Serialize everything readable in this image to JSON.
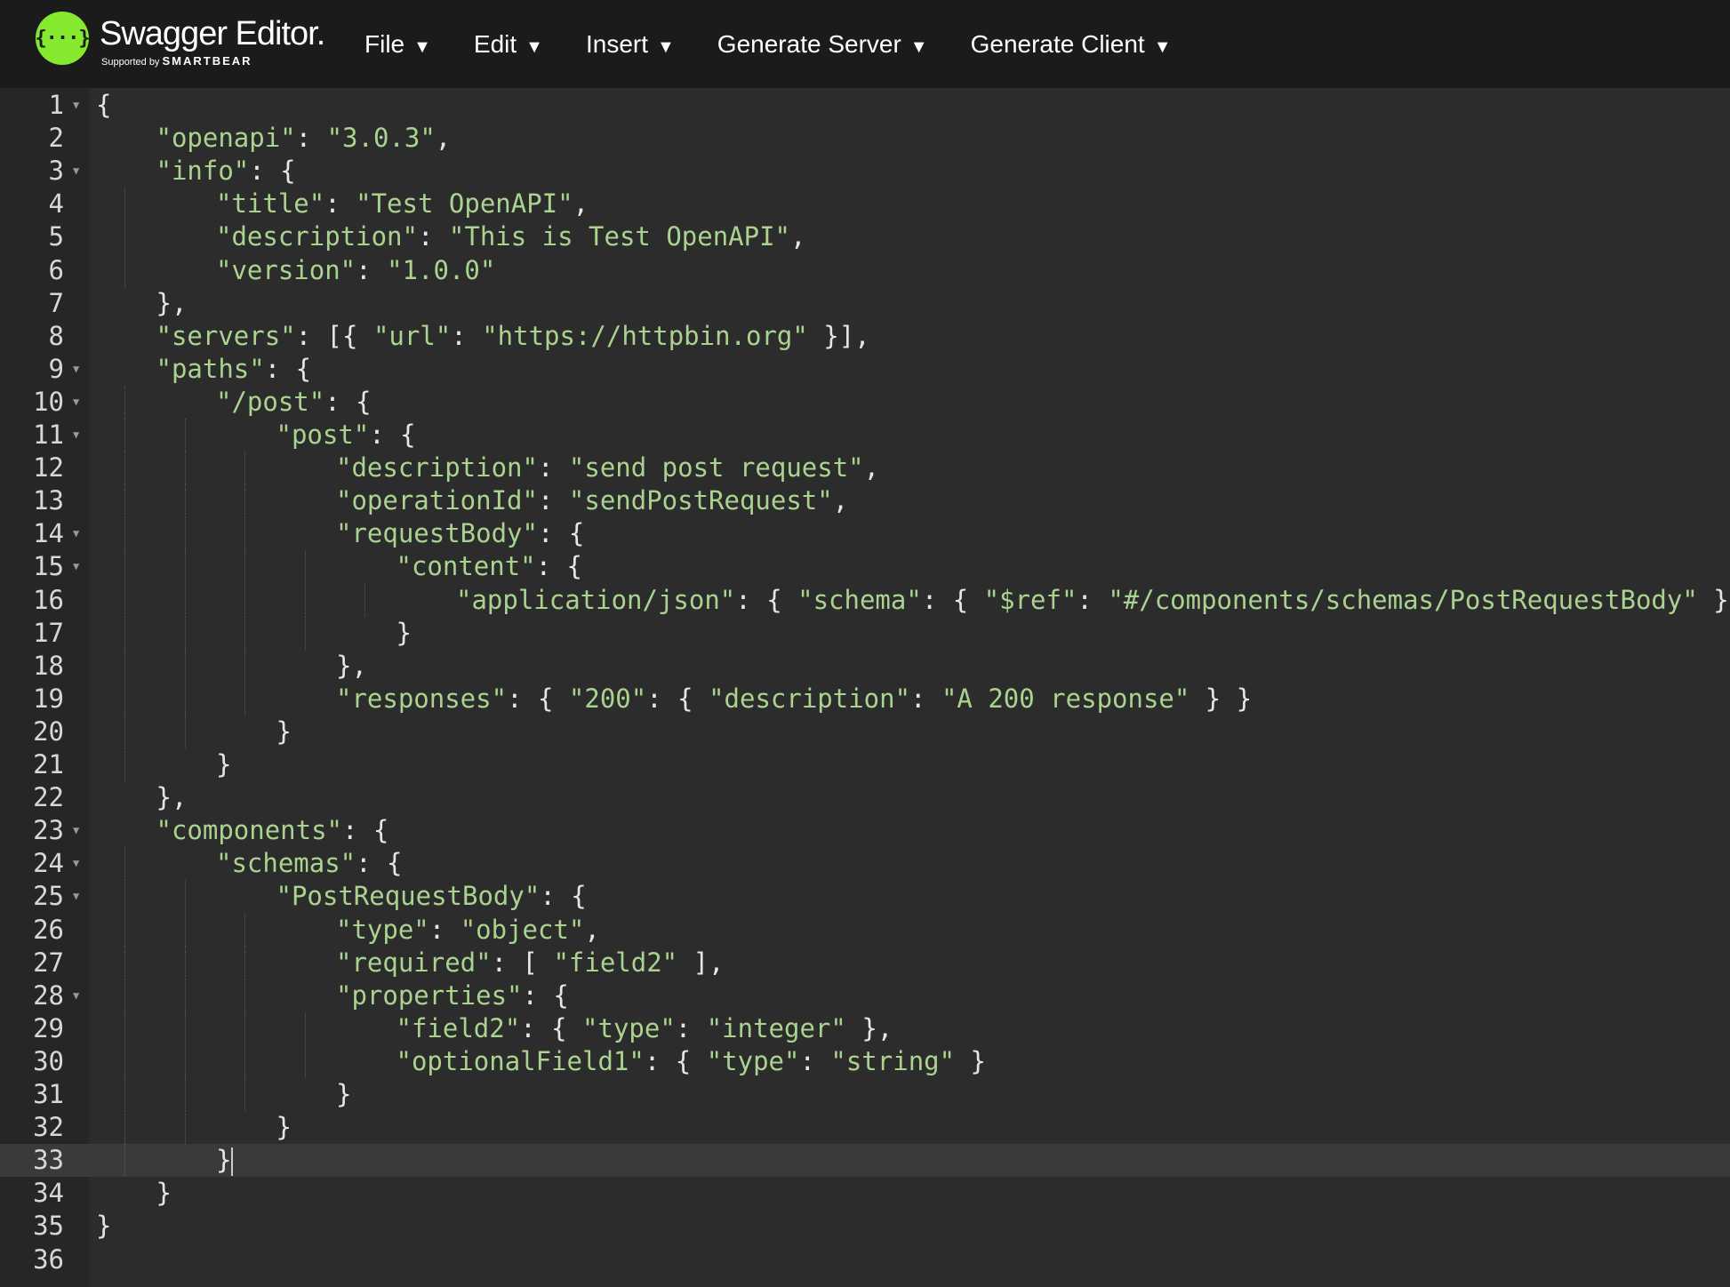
{
  "header": {
    "logo_symbol": "{···}",
    "app_title": "Swagger Editor.",
    "supported_by": "Supported by",
    "brand": "SMARTBEAR",
    "menu": [
      {
        "label": "File"
      },
      {
        "label": "Edit"
      },
      {
        "label": "Insert"
      },
      {
        "label": "Generate Server"
      },
      {
        "label": "Generate Client"
      }
    ]
  },
  "editor": {
    "active_line": 33,
    "lines": [
      {
        "n": "1",
        "indent": 0,
        "fold": true,
        "text": "{"
      },
      {
        "n": "2",
        "indent": 1,
        "fold": false,
        "text": "\"openapi\": \"3.0.3\","
      },
      {
        "n": "3",
        "indent": 1,
        "fold": true,
        "text": "\"info\": {"
      },
      {
        "n": "4",
        "indent": 2,
        "fold": false,
        "text": "\"title\": \"Test OpenAPI\","
      },
      {
        "n": "5",
        "indent": 2,
        "fold": false,
        "text": "\"description\": \"This is Test OpenAPI\","
      },
      {
        "n": "6",
        "indent": 2,
        "fold": false,
        "text": "\"version\": \"1.0.0\""
      },
      {
        "n": "7",
        "indent": 1,
        "fold": false,
        "text": "},"
      },
      {
        "n": "8",
        "indent": 1,
        "fold": false,
        "text": "\"servers\": [{ \"url\": \"https://httpbin.org\" }],"
      },
      {
        "n": "9",
        "indent": 1,
        "fold": true,
        "text": "\"paths\": {"
      },
      {
        "n": "10",
        "indent": 2,
        "fold": true,
        "text": "\"/post\": {"
      },
      {
        "n": "11",
        "indent": 3,
        "fold": true,
        "text": "\"post\": {"
      },
      {
        "n": "12",
        "indent": 4,
        "fold": false,
        "text": "\"description\": \"send post request\","
      },
      {
        "n": "13",
        "indent": 4,
        "fold": false,
        "text": "\"operationId\": \"sendPostRequest\","
      },
      {
        "n": "14",
        "indent": 4,
        "fold": true,
        "text": "\"requestBody\": {"
      },
      {
        "n": "15",
        "indent": 5,
        "fold": true,
        "text": "\"content\": {"
      },
      {
        "n": "16",
        "indent": 6,
        "fold": false,
        "text": "\"application/json\": { \"schema\": { \"$ref\": \"#/components/schemas/PostRequestBody\" } }"
      },
      {
        "n": "17",
        "indent": 5,
        "fold": false,
        "text": "}"
      },
      {
        "n": "18",
        "indent": 4,
        "fold": false,
        "text": "},"
      },
      {
        "n": "19",
        "indent": 4,
        "fold": false,
        "text": "\"responses\": { \"200\": { \"description\": \"A 200 response\" } }"
      },
      {
        "n": "20",
        "indent": 3,
        "fold": false,
        "text": "}"
      },
      {
        "n": "21",
        "indent": 2,
        "fold": false,
        "text": "}"
      },
      {
        "n": "22",
        "indent": 1,
        "fold": false,
        "text": "},"
      },
      {
        "n": "23",
        "indent": 1,
        "fold": true,
        "text": "\"components\": {"
      },
      {
        "n": "24",
        "indent": 2,
        "fold": true,
        "text": "\"schemas\": {"
      },
      {
        "n": "25",
        "indent": 3,
        "fold": true,
        "text": "\"PostRequestBody\": {"
      },
      {
        "n": "26",
        "indent": 4,
        "fold": false,
        "text": "\"type\": \"object\","
      },
      {
        "n": "27",
        "indent": 4,
        "fold": false,
        "text": "\"required\": [ \"field2\" ],"
      },
      {
        "n": "28",
        "indent": 4,
        "fold": true,
        "text": "\"properties\": {"
      },
      {
        "n": "29",
        "indent": 5,
        "fold": false,
        "text": "\"field2\": { \"type\": \"integer\" },"
      },
      {
        "n": "30",
        "indent": 5,
        "fold": false,
        "text": "\"optionalField1\": { \"type\": \"string\" }"
      },
      {
        "n": "31",
        "indent": 4,
        "fold": false,
        "text": "}"
      },
      {
        "n": "32",
        "indent": 3,
        "fold": false,
        "text": "}"
      },
      {
        "n": "33",
        "indent": 2,
        "fold": false,
        "text": "}"
      },
      {
        "n": "34",
        "indent": 1,
        "fold": false,
        "text": "}"
      },
      {
        "n": "35",
        "indent": 0,
        "fold": false,
        "text": "}"
      },
      {
        "n": "36",
        "indent": 0,
        "fold": false,
        "text": ""
      }
    ]
  }
}
